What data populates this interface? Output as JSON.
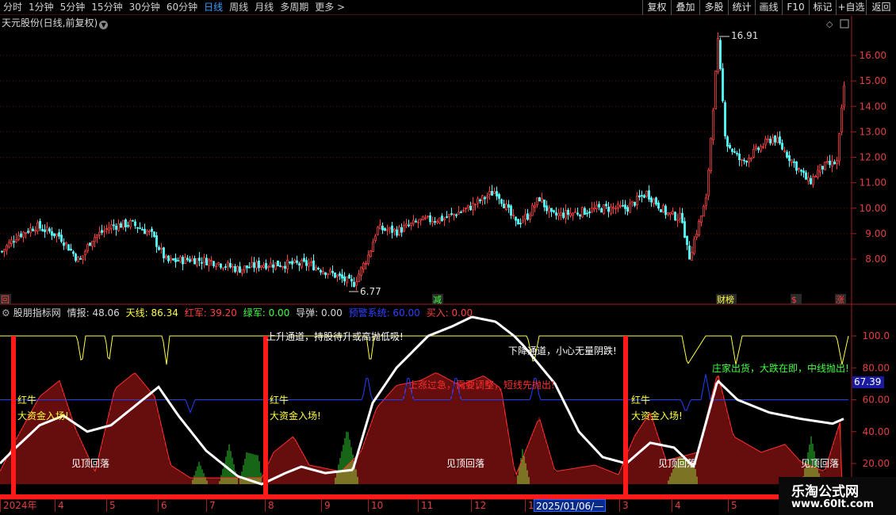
{
  "periods": [
    "分时",
    "1分钟",
    "5分钟",
    "15分钟",
    "30分钟",
    "60分钟",
    "日线",
    "周线",
    "月线",
    "多周期",
    "更多 >"
  ],
  "active_period": "日线",
  "tools": [
    "复权",
    "叠加",
    "多股",
    "统计",
    "画线",
    "F10",
    "标记",
    "+自选",
    "返回"
  ],
  "stock_caption": "天元股份(日线,前复权)",
  "price_axis": [
    "16.00",
    "15.00",
    "14.00",
    "13.00",
    "12.00",
    "11.00",
    "10.00",
    "9.00",
    "8.00"
  ],
  "price_high_label": "16.91",
  "price_low_label": "6.77",
  "event_markers": [
    {
      "label": "回",
      "color": "#ff4040"
    },
    {
      "label": "减",
      "color": "#40ff40"
    },
    {
      "label": "财榜",
      "color": "#ffff40"
    },
    {
      "label": "$",
      "color": "#ff4040"
    },
    {
      "label": "涨",
      "color": "#ff4040"
    }
  ],
  "indicator": {
    "name": "股朋指标网",
    "values": [
      {
        "text": "情报: 48.06",
        "color": "#d8d8d8"
      },
      {
        "text": "天线: 86.34",
        "color": "#ffff40"
      },
      {
        "text": "红军: 39.20",
        "color": "#ff4040"
      },
      {
        "text": "绿军: 0.00",
        "color": "#40ff40"
      },
      {
        "text": "导弹: 0.00",
        "color": "#d8d8d8"
      },
      {
        "text": "预警系统: 60.00",
        "color": "#3040ff"
      },
      {
        "text": "买入: 0.00",
        "color": "#ff4040"
      }
    ]
  },
  "ind_axis": [
    "100.0",
    "80.00",
    "60.00",
    "40.00",
    "20.00"
  ],
  "ind_current": "67.39",
  "annotations": {
    "red_bull": "红牛",
    "big_money": "大资金入场!",
    "see_top": "见顶回落",
    "up_channel": "上升通道，持股待升或高抛低吸!",
    "down_channel": "下降通道，小心无量阴跌!",
    "rise_too_fast": "上涨过急，需要调整，短线先抛出!",
    "dealer_out": "庄家出货，大跌在即，中线抛出!"
  },
  "date_axis": [
    "2024年",
    "4",
    "5",
    "6",
    "7",
    "8",
    "9",
    "10",
    "11",
    "12",
    "1",
    "3",
    "4",
    "5"
  ],
  "selected_date": "2025/01/06/—",
  "logo": {
    "name": "乐淘公式网",
    "url": "www.60lt.com"
  },
  "colors": {
    "up": "#ff3c3c",
    "down": "#54ffff",
    "line_yellow": "#ffff40",
    "line_blue": "#2040ff",
    "border": "#a02020"
  }
}
